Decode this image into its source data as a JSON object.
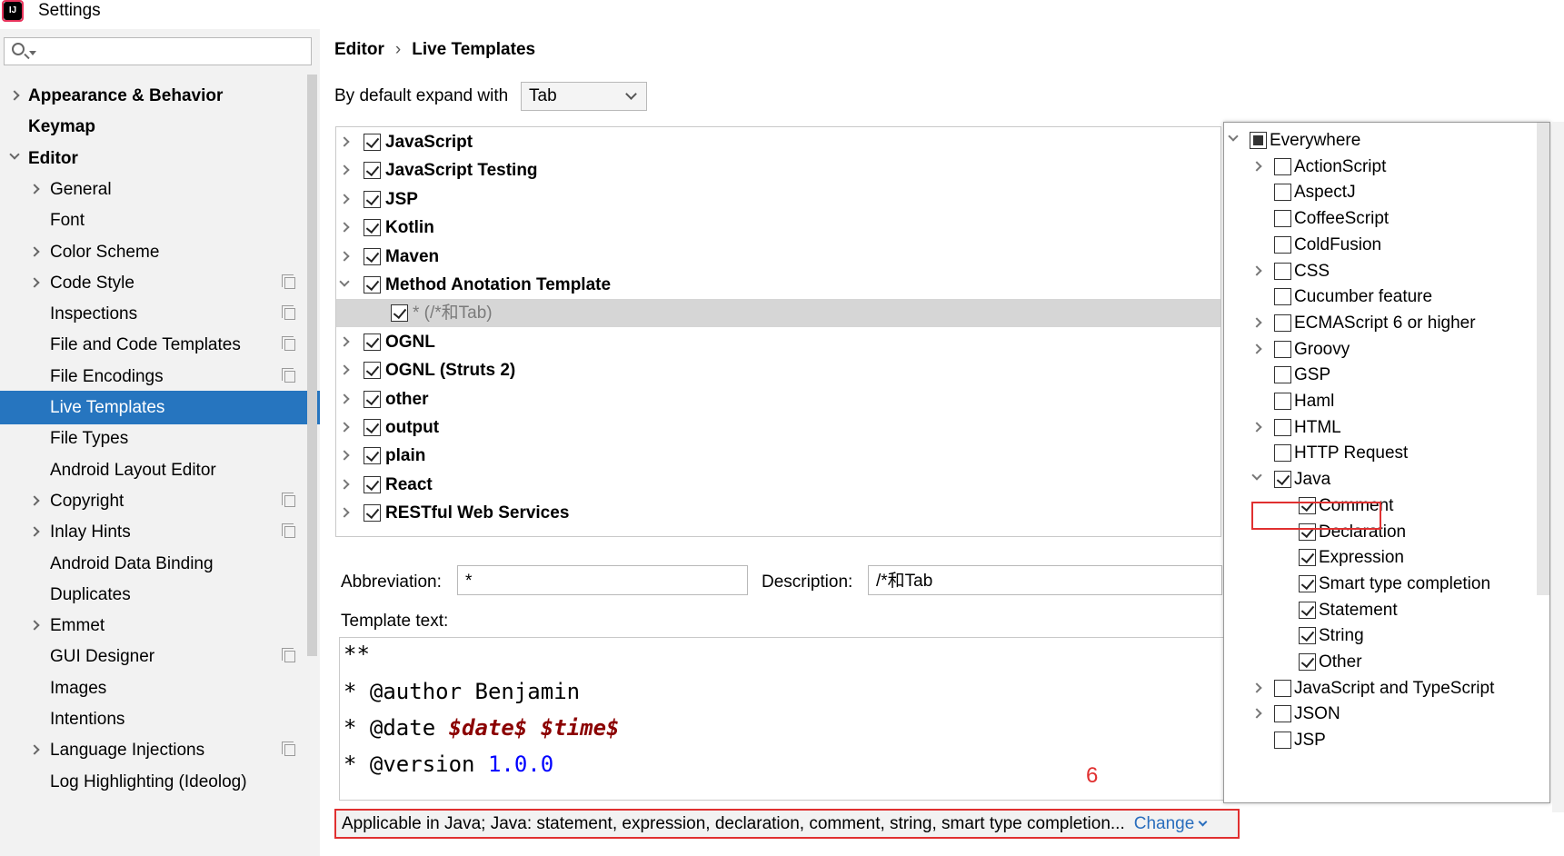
{
  "window": {
    "title": "Settings",
    "logo_text": "IJ"
  },
  "sidebar": {
    "search_value": "",
    "items": [
      {
        "label": "Appearance & Behavior",
        "bold": true,
        "arrow": "right",
        "level": 0,
        "copy": false
      },
      {
        "label": "Keymap",
        "bold": true,
        "arrow": "",
        "level": 0,
        "copy": false
      },
      {
        "label": "Editor",
        "bold": true,
        "arrow": "down",
        "level": 0,
        "copy": false
      },
      {
        "label": "General",
        "bold": false,
        "arrow": "right",
        "level": 1,
        "copy": false
      },
      {
        "label": "Font",
        "bold": false,
        "arrow": "",
        "level": 1,
        "copy": false
      },
      {
        "label": "Color Scheme",
        "bold": false,
        "arrow": "right",
        "level": 1,
        "copy": false
      },
      {
        "label": "Code Style",
        "bold": false,
        "arrow": "right",
        "level": 1,
        "copy": true
      },
      {
        "label": "Inspections",
        "bold": false,
        "arrow": "",
        "level": 1,
        "copy": true
      },
      {
        "label": "File and Code Templates",
        "bold": false,
        "arrow": "",
        "level": 1,
        "copy": true
      },
      {
        "label": "File Encodings",
        "bold": false,
        "arrow": "",
        "level": 1,
        "copy": true
      },
      {
        "label": "Live Templates",
        "bold": false,
        "arrow": "",
        "level": 1,
        "copy": false,
        "selected": true
      },
      {
        "label": "File Types",
        "bold": false,
        "arrow": "",
        "level": 1,
        "copy": false
      },
      {
        "label": "Android Layout Editor",
        "bold": false,
        "arrow": "",
        "level": 1,
        "copy": false
      },
      {
        "label": "Copyright",
        "bold": false,
        "arrow": "right",
        "level": 1,
        "copy": true
      },
      {
        "label": "Inlay Hints",
        "bold": false,
        "arrow": "right",
        "level": 1,
        "copy": true
      },
      {
        "label": "Android Data Binding",
        "bold": false,
        "arrow": "",
        "level": 1,
        "copy": false
      },
      {
        "label": "Duplicates",
        "bold": false,
        "arrow": "",
        "level": 1,
        "copy": false
      },
      {
        "label": "Emmet",
        "bold": false,
        "arrow": "right",
        "level": 1,
        "copy": false
      },
      {
        "label": "GUI Designer",
        "bold": false,
        "arrow": "",
        "level": 1,
        "copy": true
      },
      {
        "label": "Images",
        "bold": false,
        "arrow": "",
        "level": 1,
        "copy": false
      },
      {
        "label": "Intentions",
        "bold": false,
        "arrow": "",
        "level": 1,
        "copy": false
      },
      {
        "label": "Language Injections",
        "bold": false,
        "arrow": "right",
        "level": 1,
        "copy": true
      },
      {
        "label": "Log Highlighting (Ideolog)",
        "bold": false,
        "arrow": "",
        "level": 1,
        "copy": false
      }
    ]
  },
  "breadcrumb": {
    "parent": "Editor",
    "sep": "›",
    "current": "Live Templates"
  },
  "expand": {
    "label": "By default expand with",
    "value": "Tab"
  },
  "template_groups": [
    {
      "label": "JavaScript",
      "arrow": "right",
      "checked": true
    },
    {
      "label": "JavaScript Testing",
      "arrow": "right",
      "checked": true
    },
    {
      "label": "JSP",
      "arrow": "right",
      "checked": true
    },
    {
      "label": "Kotlin",
      "arrow": "right",
      "checked": true
    },
    {
      "label": "Maven",
      "arrow": "right",
      "checked": true
    },
    {
      "label": "Method Anotation Template",
      "arrow": "down",
      "checked": true
    },
    {
      "label": "* (/*和Tab)",
      "arrow": "",
      "checked": true,
      "child": true
    },
    {
      "label": "OGNL",
      "arrow": "right",
      "checked": true
    },
    {
      "label": "OGNL (Struts 2)",
      "arrow": "right",
      "checked": true
    },
    {
      "label": "other",
      "arrow": "right",
      "checked": true
    },
    {
      "label": "output",
      "arrow": "right",
      "checked": true
    },
    {
      "label": "plain",
      "arrow": "right",
      "checked": true
    },
    {
      "label": "React",
      "arrow": "right",
      "checked": true
    },
    {
      "label": "RESTful Web Services",
      "arrow": "right",
      "checked": true
    }
  ],
  "abbreviation": {
    "label": "Abbreviation:",
    "value": "*"
  },
  "description": {
    "label": "Description:",
    "value": "/*和Tab"
  },
  "template_text": {
    "label": "Template text:",
    "lines": [
      {
        "prefix": "**",
        "parts": []
      },
      {
        "prefix": "* ",
        "parts": [
          {
            "t": "@author Benjamin",
            "k": "plain"
          }
        ]
      },
      {
        "prefix": "* ",
        "parts": [
          {
            "t": "@date ",
            "k": "plain"
          },
          {
            "t": "$date$",
            "k": "var"
          },
          {
            "t": " ",
            "k": "plain"
          },
          {
            "t": "$time$",
            "k": "var"
          }
        ]
      },
      {
        "prefix": "* ",
        "parts": [
          {
            "t": "@version ",
            "k": "plain"
          },
          {
            "t": "1.0.0",
            "k": "num"
          }
        ]
      }
    ]
  },
  "annotation_number": "6",
  "applicable": {
    "text": "Applicable in Java; Java: statement, expression, declaration, comment, string, smart type completion...",
    "change_label": "Change"
  },
  "context_popup": {
    "items": [
      {
        "label": "Everywhere",
        "arrow": "down",
        "state": "partial",
        "level": 0
      },
      {
        "label": "ActionScript",
        "arrow": "right",
        "state": "unchecked",
        "level": 1
      },
      {
        "label": "AspectJ",
        "arrow": "",
        "state": "unchecked",
        "level": 1
      },
      {
        "label": "CoffeeScript",
        "arrow": "",
        "state": "unchecked",
        "level": 1
      },
      {
        "label": "ColdFusion",
        "arrow": "",
        "state": "unchecked",
        "level": 1
      },
      {
        "label": "CSS",
        "arrow": "right",
        "state": "unchecked",
        "level": 1
      },
      {
        "label": "Cucumber feature",
        "arrow": "",
        "state": "unchecked",
        "level": 1
      },
      {
        "label": "ECMAScript 6 or higher",
        "arrow": "right",
        "state": "unchecked",
        "level": 1
      },
      {
        "label": "Groovy",
        "arrow": "right",
        "state": "unchecked",
        "level": 1
      },
      {
        "label": "GSP",
        "arrow": "",
        "state": "unchecked",
        "level": 1
      },
      {
        "label": "Haml",
        "arrow": "",
        "state": "unchecked",
        "level": 1
      },
      {
        "label": "HTML",
        "arrow": "right",
        "state": "unchecked",
        "level": 1
      },
      {
        "label": "HTTP Request",
        "arrow": "",
        "state": "unchecked",
        "level": 1
      },
      {
        "label": "Java",
        "arrow": "down",
        "state": "checked",
        "level": 1
      },
      {
        "label": "Comment",
        "arrow": "",
        "state": "checked",
        "level": 2
      },
      {
        "label": "Declaration",
        "arrow": "",
        "state": "checked",
        "level": 2
      },
      {
        "label": "Expression",
        "arrow": "",
        "state": "checked",
        "level": 2
      },
      {
        "label": "Smart type completion",
        "arrow": "",
        "state": "checked",
        "level": 2
      },
      {
        "label": "Statement",
        "arrow": "",
        "state": "checked",
        "level": 2
      },
      {
        "label": "String",
        "arrow": "",
        "state": "checked",
        "level": 2
      },
      {
        "label": "Other",
        "arrow": "",
        "state": "checked",
        "level": 2
      },
      {
        "label": "JavaScript and TypeScript",
        "arrow": "right",
        "state": "unchecked",
        "level": 1
      },
      {
        "label": "JSON",
        "arrow": "right",
        "state": "unchecked",
        "level": 1
      },
      {
        "label": "JSP",
        "arrow": "",
        "state": "unchecked",
        "level": 1
      }
    ]
  },
  "colors": {
    "selection": "#2675bf",
    "annotation": "#e03030",
    "link": "#2a6ebd",
    "template_var": "#8b0000",
    "template_num": "#0000ff"
  }
}
